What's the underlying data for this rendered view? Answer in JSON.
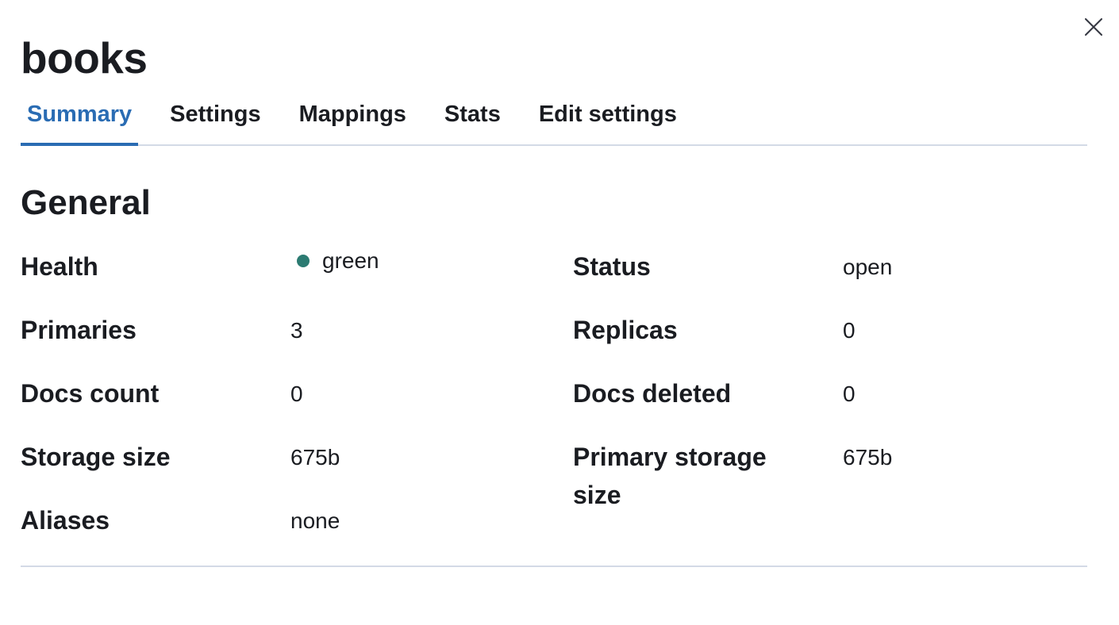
{
  "flyout": {
    "title": "books",
    "close_icon": "close-icon"
  },
  "tabs": [
    {
      "label": "Summary",
      "active": true
    },
    {
      "label": "Settings",
      "active": false
    },
    {
      "label": "Mappings",
      "active": false
    },
    {
      "label": "Stats",
      "active": false
    },
    {
      "label": "Edit settings",
      "active": false
    }
  ],
  "general": {
    "title": "General",
    "left": [
      {
        "label": "Health",
        "value": "green"
      },
      {
        "label": "Primaries",
        "value": "3"
      },
      {
        "label": "Docs count",
        "value": "0"
      },
      {
        "label": "Storage size",
        "value": "675b"
      },
      {
        "label": "Aliases",
        "value": "none"
      }
    ],
    "right": [
      {
        "label": "Status",
        "value": "open"
      },
      {
        "label": "Replicas",
        "value": "0"
      },
      {
        "label": "Docs deleted",
        "value": "0"
      },
      {
        "label": "Primary storage size",
        "value": "675b"
      }
    ]
  },
  "colors": {
    "accent": "#2a6cb3",
    "health_green": "#2c7b72",
    "border": "#d3dae6",
    "text": "#1a1c21"
  }
}
